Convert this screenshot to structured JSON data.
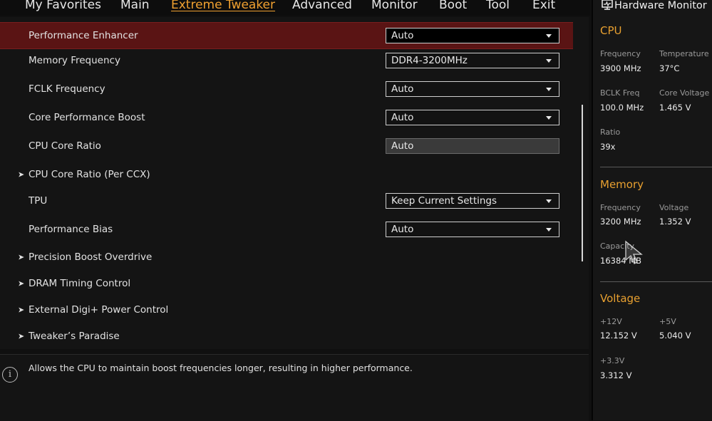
{
  "nav": {
    "items": [
      "My Favorites",
      "Main",
      "Extreme Tweaker",
      "Advanced",
      "Monitor",
      "Boot",
      "Tool",
      "Exit"
    ],
    "active": "Extreme Tweaker"
  },
  "settings": [
    {
      "label": "Performance Enhancer",
      "value": "Auto"
    },
    {
      "label": "Memory Frequency",
      "value": "DDR4-3200MHz"
    },
    {
      "label": "FCLK Frequency",
      "value": "Auto"
    },
    {
      "label": "Core Performance Boost",
      "value": "Auto"
    },
    {
      "label": "CPU Core Ratio",
      "value": "Auto"
    },
    {
      "label": "CPU Core Ratio (Per CCX)"
    },
    {
      "label": "TPU",
      "value": "Keep Current Settings"
    },
    {
      "label": "Performance Bias",
      "value": "Auto"
    },
    {
      "label": "Precision Boost Overdrive"
    },
    {
      "label": "DRAM Timing Control"
    },
    {
      "label": "External Digi+ Power Control"
    },
    {
      "label": "Tweaker’s Paradise"
    }
  ],
  "help": {
    "text": "Allows the CPU to maintain boost frequencies longer, resulting in higher performance.",
    "icon": "info-icon"
  },
  "hw_monitor": {
    "title": "Hardware Monitor",
    "cpu": {
      "section": "CPU",
      "frequency_label": "Frequency",
      "frequency": "3900 MHz",
      "temperature_label": "Temperature",
      "temperature": "37°C",
      "bclk_label": "BCLK Freq",
      "bclk": "100.0 MHz",
      "core_voltage_label": "Core Voltage",
      "core_voltage": "1.465 V",
      "ratio_label": "Ratio",
      "ratio": "39x"
    },
    "memory": {
      "section": "Memory",
      "frequency_label": "Frequency",
      "frequency": "3200 MHz",
      "voltage_label": "Voltage",
      "voltage": "1.352 V",
      "capacity_label": "Capacity",
      "capacity": "16384 MB"
    },
    "voltage": {
      "section": "Voltage",
      "v12_label": "+12V",
      "v12": "12.152 V",
      "v5_label": "+5V",
      "v5": "5.040 V",
      "v33_label": "+3.3V",
      "v33": "3.312 V"
    }
  },
  "colors": {
    "accent": "#f0a030",
    "selected_row": "#5a1414",
    "section": "#e8a030"
  }
}
